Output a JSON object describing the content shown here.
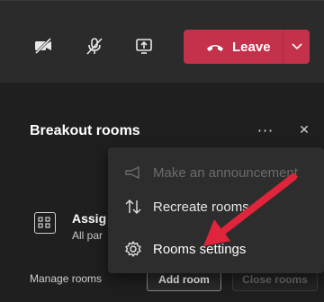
{
  "toolbar": {
    "leave_label": "Leave"
  },
  "panel": {
    "title": "Breakout rooms",
    "more_label": "···",
    "close_label": "✕"
  },
  "assign": {
    "title": "Assig",
    "subtitle": "All par"
  },
  "menu": {
    "items": [
      {
        "label": "Make an announcement",
        "enabled": false
      },
      {
        "label": "Recreate rooms",
        "enabled": true
      },
      {
        "label": "Rooms settings",
        "enabled": true
      }
    ]
  },
  "manage": {
    "label": "Manage rooms",
    "add_room_label": "Add room",
    "close_rooms_label": "Close rooms"
  },
  "colors": {
    "leave_button": "#c4314b",
    "annotation_arrow": "#e0243b",
    "panel_background": "#1f1f1f",
    "menu_background": "#2d2d2d"
  },
  "icons": {
    "camera": "camera-off-icon",
    "mic": "mic-off-icon",
    "share": "share-screen-icon",
    "leave": "phone-hangup-icon",
    "chevron": "chevron-down-icon",
    "assign": "assign-participants-icon",
    "announce": "megaphone-icon",
    "recreate": "recreate-arrows-icon",
    "settings": "gear-icon"
  }
}
